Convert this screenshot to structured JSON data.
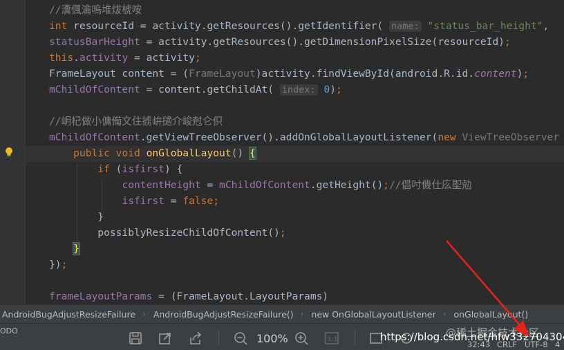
{
  "code": {
    "lines": [
      {
        "segs": [
          {
            "c": "cmt",
            "t": "//瀵偑瀹嗚堆炦椃咹"
          }
        ]
      },
      {
        "segs": [
          {
            "c": "kw",
            "t": "int "
          },
          {
            "c": "",
            "t": "resourceId = activity.getResources().getIdentifier( "
          },
          {
            "c": "hint",
            "t": "name:"
          },
          {
            "c": "",
            "t": " "
          },
          {
            "c": "str",
            "t": "\"status_bar_height\""
          },
          {
            "c": "",
            "t": ","
          }
        ]
      },
      {
        "segs": [
          {
            "c": "fld",
            "t": "statusBarHeight"
          },
          {
            "c": "",
            "t": " = activity.getResources().getDimensionPixelSize(resourceId)"
          },
          {
            "c": "kw",
            "t": ";"
          }
        ]
      },
      {
        "segs": [
          {
            "c": "kw",
            "t": "this"
          },
          {
            "c": "",
            "t": "."
          },
          {
            "c": "fld",
            "t": "activity"
          },
          {
            "c": "",
            "t": " = activity"
          },
          {
            "c": "kw",
            "t": ";"
          }
        ]
      },
      {
        "segs": [
          {
            "c": "",
            "t": "FrameLayout content = ("
          },
          {
            "c": "cast",
            "t": "FrameLayout"
          },
          {
            "c": "",
            "t": ")activity.findViewById(android.R.id."
          },
          {
            "c": "fld it",
            "t": "content"
          },
          {
            "c": "",
            "t": ")"
          },
          {
            "c": "kw",
            "t": ";"
          }
        ]
      },
      {
        "segs": [
          {
            "c": "fld",
            "t": "mChildOfContent"
          },
          {
            "c": "",
            "t": " = content.getChildAt( "
          },
          {
            "c": "hint",
            "t": "index:"
          },
          {
            "c": "",
            "t": " "
          },
          {
            "c": "num",
            "t": "0"
          },
          {
            "c": "",
            "t": ")"
          },
          {
            "c": "kw",
            "t": ";"
          }
        ]
      },
      {
        "segs": []
      },
      {
        "segs": [
          {
            "c": "cmt",
            "t": "//岄杞做小傭僃文住掳峅擿介峻尅仑伿"
          }
        ]
      },
      {
        "segs": [
          {
            "c": "fld",
            "t": "mChildOfContent"
          },
          {
            "c": "",
            "t": ".getViewTreeObserver().addOnGlobalLayoutListener("
          },
          {
            "c": "kw",
            "t": "new "
          },
          {
            "c": "cast",
            "t": "ViewTreeObserver"
          }
        ]
      },
      {
        "segs": [
          {
            "c": "",
            "t": "    "
          },
          {
            "c": "kw",
            "t": "public void "
          },
          {
            "c": "fn",
            "t": "onGlobalLayout"
          },
          {
            "c": "",
            "t": "() "
          },
          {
            "c": "brace-hl",
            "t": "{"
          }
        ]
      },
      {
        "segs": [
          {
            "c": "",
            "t": "        "
          },
          {
            "c": "kw",
            "t": "if "
          },
          {
            "c": "",
            "t": "("
          },
          {
            "c": "fld",
            "t": "isfirst"
          },
          {
            "c": "",
            "t": ") {"
          }
        ]
      },
      {
        "segs": [
          {
            "c": "",
            "t": "            "
          },
          {
            "c": "fld",
            "t": "contentHeight"
          },
          {
            "c": "",
            "t": " = "
          },
          {
            "c": "fld",
            "t": "mChildOfContent"
          },
          {
            "c": "",
            "t": ".getHeight()"
          },
          {
            "c": "kw",
            "t": ";"
          },
          {
            "c": "cmt",
            "t": "//倡吋僟仕庅堲勊"
          }
        ]
      },
      {
        "segs": [
          {
            "c": "",
            "t": "            "
          },
          {
            "c": "fld",
            "t": "isfirst"
          },
          {
            "c": "",
            "t": " = "
          },
          {
            "c": "kw",
            "t": "false;"
          }
        ]
      },
      {
        "segs": [
          {
            "c": "",
            "t": "        }"
          }
        ]
      },
      {
        "segs": [
          {
            "c": "",
            "t": "        possiblyResizeChildOfContent()"
          },
          {
            "c": "kw",
            "t": ";"
          }
        ]
      },
      {
        "segs": [
          {
            "c": "",
            "t": "    "
          },
          {
            "c": "brace-hl",
            "t": "}"
          }
        ]
      },
      {
        "segs": [
          {
            "c": "",
            "t": "})"
          },
          {
            "c": "kw",
            "t": ";"
          }
        ]
      },
      {
        "segs": []
      },
      {
        "segs": [
          {
            "c": "fld",
            "t": "frameLayoutParams"
          },
          {
            "c": "",
            "t": " = (FrameLayout.LayoutParams)"
          }
        ]
      }
    ]
  },
  "breadcrumb": {
    "items": [
      "AndroidBugAdjustResizeFailure",
      "AndroidBugAdjustResizeFailure()",
      "new OnGlobalLayoutListener",
      "onGlobalLayout()"
    ]
  },
  "toolbar": {
    "todo_label": "ODO",
    "zoom": "100%",
    "position": "32:43",
    "line_sep": "CRLF",
    "encoding": "UTF-8",
    "indent": "4"
  },
  "watermark": "@稀土掘金技术社区",
  "url_overlay": "https://blog.csdn.net/hfw332704304",
  "colors": {
    "arrow": "#e8221b",
    "background": "#2b2b2b"
  }
}
